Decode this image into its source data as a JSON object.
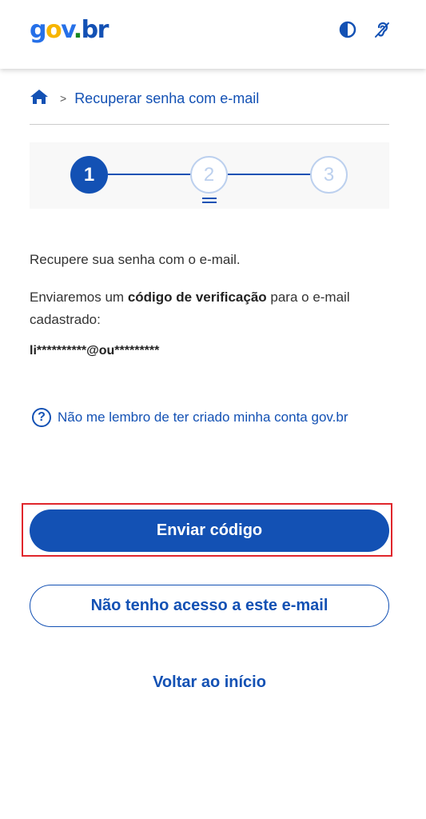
{
  "header": {
    "logo": {
      "g": "g",
      "o": "o",
      "v": "v",
      "dot": ".",
      "br": "br"
    },
    "icons": [
      "contrast-icon",
      "accessibility-icon"
    ],
    "colors": {
      "primary": "#1351b4",
      "logo_blue": "#2670e8",
      "logo_yellow": "#f7b500",
      "logo_green": "#168821"
    }
  },
  "breadcrumb": {
    "separator": ">",
    "current": "Recuperar senha com e-mail"
  },
  "stepper": {
    "steps": [
      "1",
      "2",
      "3"
    ],
    "current": 1
  },
  "content": {
    "intro": "Recupere sua senha com o e-mail.",
    "desc_before": "Enviaremos um ",
    "desc_bold": "código de verificação",
    "desc_after": " para o e-mail cadastrado:",
    "email": "li**********@ou*********"
  },
  "help_link": {
    "label": "Não me lembro de ter criado minha conta gov.br"
  },
  "actions": {
    "primary": "Enviar código",
    "secondary": "Não tenho acesso a este e-mail",
    "back": "Voltar ao início"
  }
}
